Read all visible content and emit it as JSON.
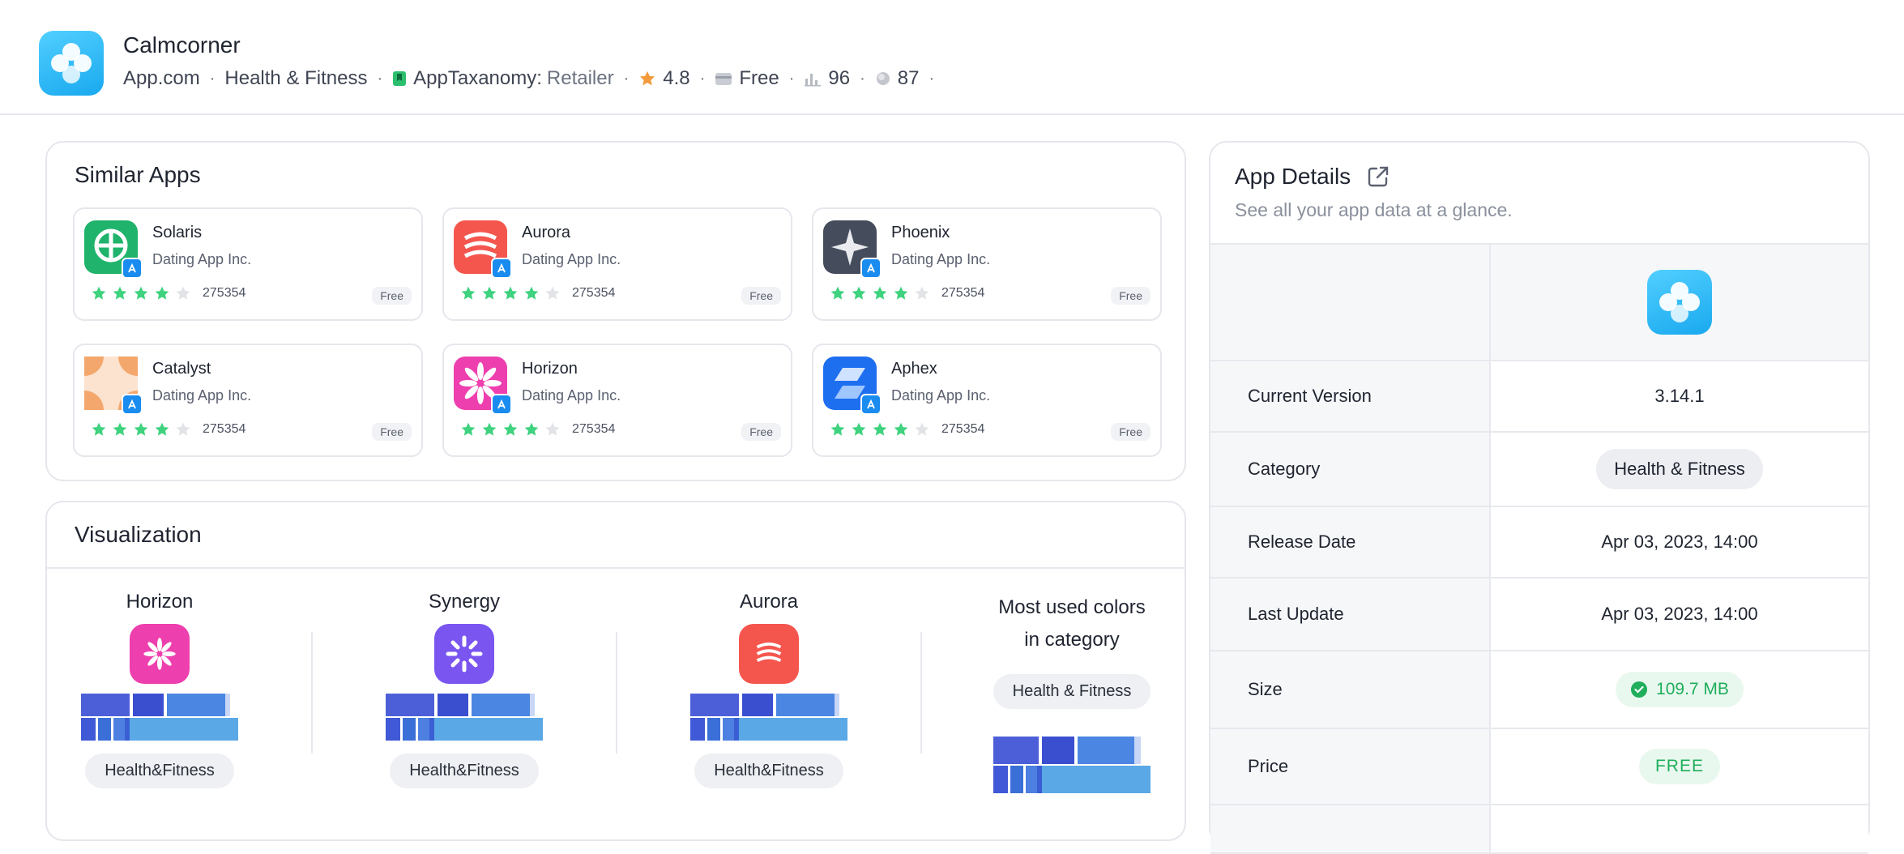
{
  "header": {
    "app_name": "Calmcorner",
    "store": "App.com",
    "category": "Health & Fitness",
    "taxonomy_label": "AppTaxanomy:",
    "taxonomy_value": "Retailer",
    "rating": "4.8",
    "price": "Free",
    "rank": "96",
    "score": "87"
  },
  "similar_apps": {
    "title": "Similar Apps",
    "items": [
      {
        "name": "Solaris",
        "developer": "Dating App Inc.",
        "reviews": "275354",
        "price": "Free",
        "stars": 4,
        "color": "#1fb36b"
      },
      {
        "name": "Aurora",
        "developer": "Dating App Inc.",
        "reviews": "275354",
        "price": "Free",
        "stars": 4,
        "color": "#f4564e"
      },
      {
        "name": "Phoenix",
        "developer": "Dating App Inc.",
        "reviews": "275354",
        "price": "Free",
        "stars": 4,
        "color": "#454c5c"
      },
      {
        "name": "Catalyst",
        "developer": "Dating App Inc.",
        "reviews": "275354",
        "price": "Free",
        "stars": 4,
        "color": "#f3a76c"
      },
      {
        "name": "Horizon",
        "developer": "Dating App Inc.",
        "reviews": "275354",
        "price": "Free",
        "stars": 4,
        "color": "#ee3fae"
      },
      {
        "name": "Aphex",
        "developer": "Dating App Inc.",
        "reviews": "275354",
        "price": "Free",
        "stars": 4,
        "color": "#1e6ff0"
      }
    ]
  },
  "visualization": {
    "title": "Visualization",
    "columns": [
      {
        "name": "Horizon",
        "tag": "Health&Fitness",
        "color": "#ee3fae"
      },
      {
        "name": "Synergy",
        "tag": "Health&Fitness",
        "color": "#7a55f0"
      },
      {
        "name": "Aurora",
        "tag": "Health&Fitness",
        "color": "#f4564e"
      }
    ],
    "most_used_line1": "Most used colors",
    "most_used_line2": "in category",
    "most_used_tag": "Health & Fitness"
  },
  "details": {
    "title": "App Details",
    "subtitle": "See all your app data at a glance.",
    "rows": {
      "current_version_label": "Current Version",
      "current_version": "3.14.1",
      "category_label": "Category",
      "category": "Health & Fitness",
      "release_label": "Release Date",
      "release": "Apr 03, 2023, 14:00",
      "update_label": "Last Update",
      "update": "Apr 03, 2023, 14:00",
      "size_label": "Size",
      "size": "109.7 MB",
      "price_label": "Price",
      "price": "FREE"
    }
  }
}
